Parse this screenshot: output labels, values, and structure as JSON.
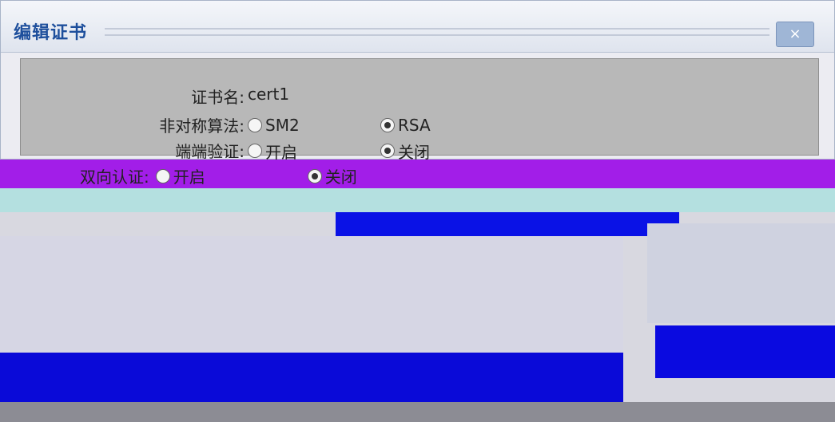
{
  "dialog": {
    "title": "编辑证书",
    "close_label": "×"
  },
  "form": {
    "name_label": "证书名:",
    "name_value": "cert1",
    "algo_label": "非对称算法:",
    "algo_options": [
      "SM2",
      "RSA"
    ],
    "algo_selected": "RSA",
    "verify_label": "端端验证:",
    "verify_options": [
      "开启",
      "关闭"
    ],
    "verify_selected": "关闭"
  },
  "second_dialog": {
    "verify_label": "双向认证:",
    "verify_options": [
      "开启",
      "关闭"
    ],
    "verify_selected": "关闭"
  },
  "colors": {
    "title_text": "#1e4f9c",
    "band_purple": "#a21ee8",
    "band_blue": "#0a12e6"
  }
}
